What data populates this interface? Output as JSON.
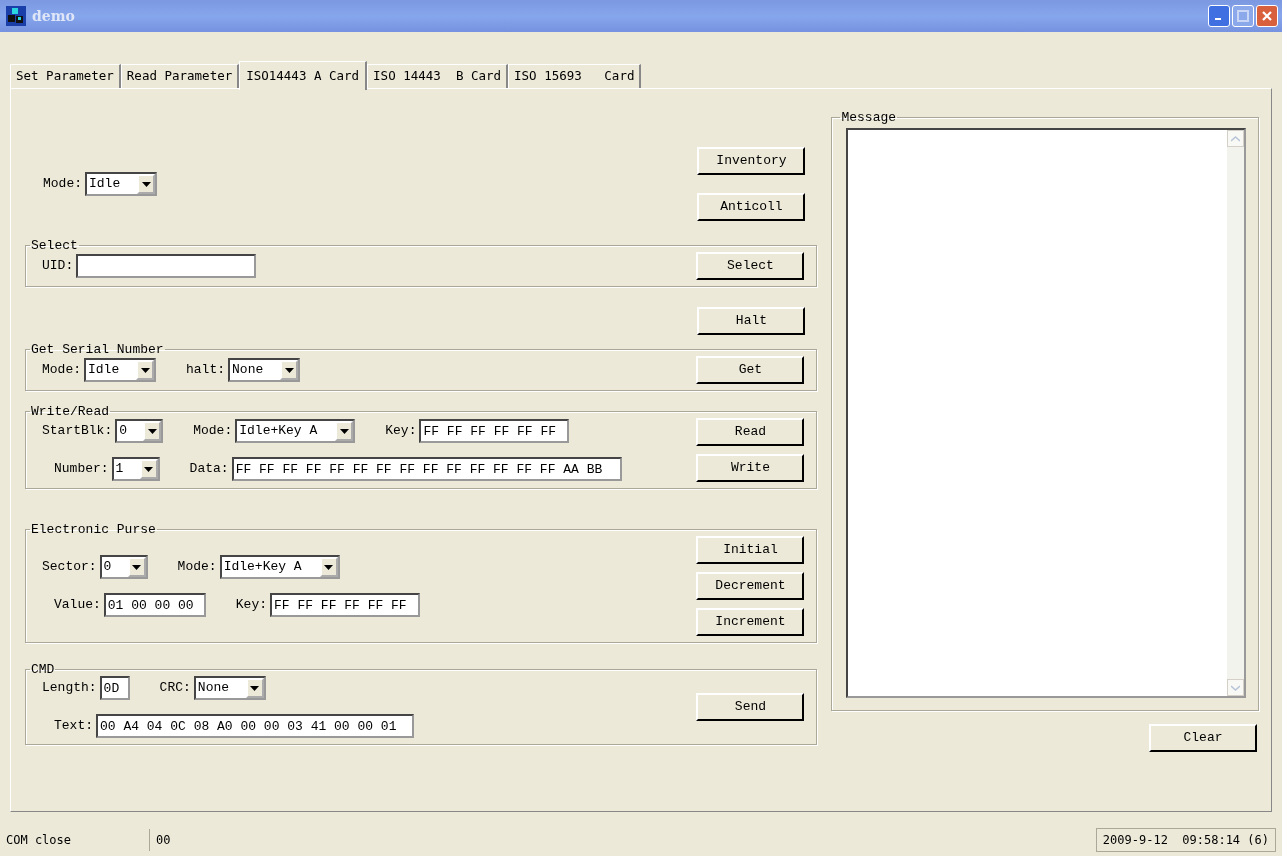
{
  "window": {
    "title": "demo"
  },
  "tabs": [
    {
      "label": "Set Parameter",
      "selected": false
    },
    {
      "label": "Read Parameter",
      "selected": false
    },
    {
      "label": "ISO14443 A Card",
      "selected": true
    },
    {
      "label": "ISO 14443  B Card",
      "selected": false
    },
    {
      "label": "ISO 15693   Card",
      "selected": false
    }
  ],
  "blocks": [
    {
      "kind": "plain",
      "rows": [
        [
          {
            "kind": "combo",
            "label": "Mode:",
            "value": "Idle"
          }
        ]
      ],
      "buttons": [
        "Inventory",
        "Anticoll"
      ]
    },
    {
      "kind": "group",
      "title": "Select",
      "rows": [
        [
          {
            "kind": "text",
            "label": "UID:"
          }
        ]
      ],
      "buttons": [
        "Select"
      ]
    },
    {
      "kind": "plain",
      "buttons": [
        "Halt"
      ]
    },
    {
      "kind": "group",
      "title": "Get Serial Number",
      "rows": [
        [
          {
            "kind": "combo",
            "label": "Mode:",
            "value": "Idle"
          },
          {
            "kind": "combo",
            "label": "halt:",
            "value": "None"
          }
        ]
      ],
      "buttons": [
        "Get"
      ]
    },
    {
      "kind": "group",
      "title": "Write/Read",
      "rows": [
        [
          {
            "kind": "combo",
            "label": "StartBlk:",
            "value": "0"
          },
          {
            "kind": "combo",
            "label": "Mode:",
            "value": "Idle+Key A"
          },
          {
            "kind": "text",
            "label": "Key:",
            "value": "FF FF FF FF FF FF"
          }
        ],
        [
          {
            "kind": "combo",
            "label": "Number:",
            "value": "1"
          },
          {
            "kind": "text",
            "label": "Data:",
            "value": "FF FF FF FF FF FF FF FF FF FF FF FF FF FF AA BB"
          }
        ]
      ],
      "buttons": [
        "Read",
        "Write"
      ]
    },
    {
      "kind": "group",
      "title": "Electronic Purse",
      "rows": [
        [
          {
            "kind": "combo",
            "label": "Sector:",
            "value": "0"
          },
          {
            "kind": "combo",
            "label": "Mode:",
            "value": "Idle+Key A"
          }
        ],
        [
          {
            "kind": "text",
            "label": "Value:",
            "value": "01 00 00 00"
          },
          {
            "kind": "text",
            "label": "Key:",
            "value": "FF FF FF FF FF FF"
          }
        ]
      ],
      "buttons": [
        "Initial",
        "Decrement",
        "Increment"
      ]
    },
    {
      "kind": "group",
      "title": "CMD",
      "rows": [
        [
          {
            "kind": "text",
            "label": "Length:",
            "value": "0D"
          },
          {
            "kind": "combo",
            "label": "CRC:",
            "value": "None"
          }
        ],
        [
          {
            "kind": "text",
            "label": "Text:",
            "value": "00 A4 04 0C 08 A0 00 00 03 41 00 00 01"
          }
        ]
      ],
      "buttons": [
        "Send"
      ]
    }
  ],
  "message": {
    "title": "Message",
    "button": "Clear"
  },
  "status_bar": [
    "COM close",
    "00",
    "2009-9-12  09:58:14 (6)"
  ]
}
